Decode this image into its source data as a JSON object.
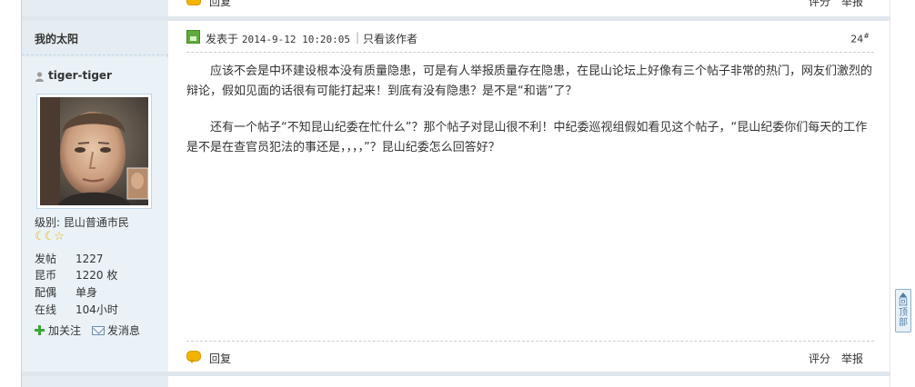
{
  "prev_post": {
    "reply_label": "回复",
    "rate_label": "评分",
    "report_label": "举报"
  },
  "sidebar": {
    "title": "我的太阳",
    "username": "tiger-tiger",
    "rank": "级别: 昆山普通市民",
    "stars": "☾☾☆",
    "stats": [
      {
        "key": "发帖",
        "value": "1227"
      },
      {
        "key": "昆币",
        "value": "1220 枚"
      },
      {
        "key": "配偶",
        "value": "单身"
      },
      {
        "key": "在线",
        "value": "104小时"
      }
    ],
    "follow_label": "加关注",
    "message_label": "发消息"
  },
  "post": {
    "posted_label": "发表于",
    "posted_time": "2014-9-12 10:20:05",
    "pipe": "|",
    "only_author": "只看该作者",
    "floor_number": "24",
    "floor_mark": "#",
    "paragraphs": [
      "应该不会是中环建设根本没有质量隐患，可是有人举报质量存在隐患，在昆山论坛上好像有三个帖子非常的热门，网友们激烈的辩论，假如见面的话很有可能打起来！到底有没有隐患？是不是“和谐”了？",
      "还有一个帖子“不知昆山纪委在忙什么”？那个帖子对昆山很不利！中纪委巡视组假如看见这个帖子，“昆山纪委你们每天的工作是不是在查官员犯法的事还是，，，，”？昆山纪委怎么回答好？"
    ],
    "reply_label": "回复",
    "rate_label": "评分",
    "report_label": "举报"
  },
  "back_to_top": "回顶部",
  "colors": {
    "sidebar_bg": "#e5edf2",
    "border": "#c2d5e3",
    "reply_icon": "#f2b400",
    "post_icon": "#60ab3c"
  }
}
